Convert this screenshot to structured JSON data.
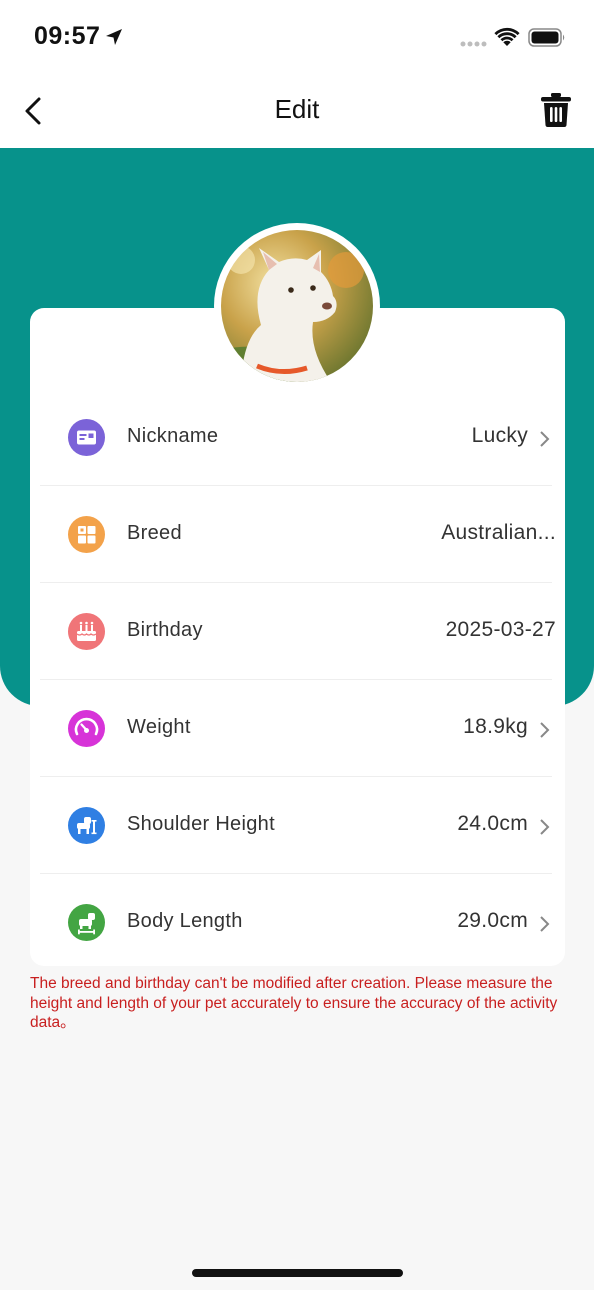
{
  "status_bar": {
    "time": "09:57"
  },
  "nav": {
    "title": "Edit"
  },
  "fields": [
    {
      "label": "Nickname",
      "value": "Lucky",
      "icon": "id-card-icon",
      "color": "#7b63d8",
      "editable": true
    },
    {
      "label": "Breed",
      "value": "Australian...",
      "icon": "breed-grid-icon",
      "color": "#f3a24a",
      "editable": false
    },
    {
      "label": "Birthday",
      "value": "2025-03-27",
      "icon": "cake-icon",
      "color": "#f07578",
      "editable": false
    },
    {
      "label": "Weight",
      "value": "18.9kg",
      "icon": "gauge-icon",
      "color": "#d733d8",
      "editable": true
    },
    {
      "label": "Shoulder Height",
      "value": "24.0cm",
      "icon": "dog-height-icon",
      "color": "#2f7fe3",
      "editable": true
    },
    {
      "label": "Body Length",
      "value": "29.0cm",
      "icon": "dog-length-icon",
      "color": "#43a543",
      "editable": true
    }
  ],
  "note": "The breed and birthday can't be modified after creation. Please measure the height and length of your pet accurately to ensure the accuracy of the activity data。",
  "colors": {
    "header": "#07928b",
    "note": "#c81f1f"
  }
}
